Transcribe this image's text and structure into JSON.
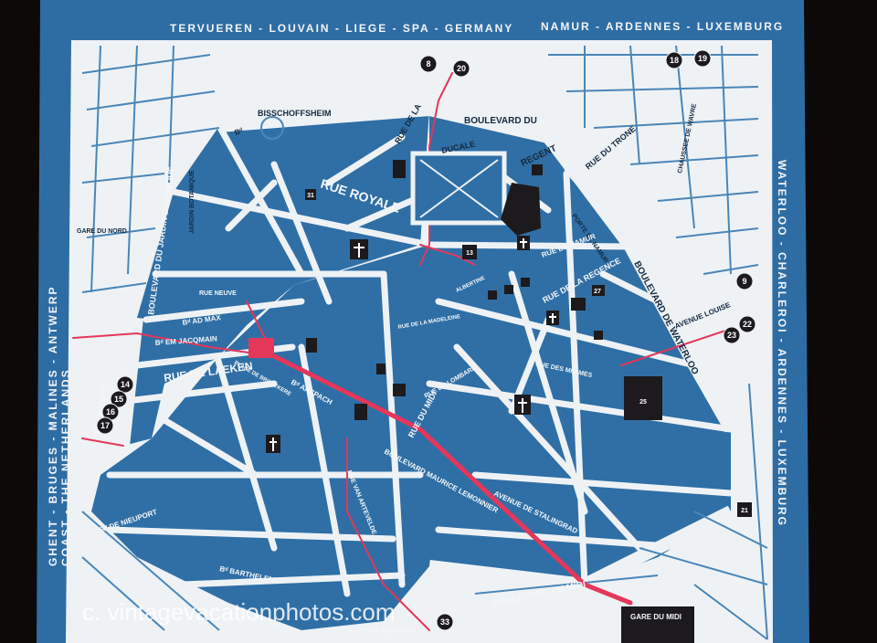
{
  "edges": {
    "top_left": "TERVUEREN - LOUVAIN - LIEGE - SPA - GERMANY",
    "top_right": "NAMUR - ARDENNES - LUXEMBURG",
    "right": "WATERLOO - CHARLEROI - ARDENNES - LUXEMBURG",
    "left_outer": "GHENT - BRUGES - MALINES - ANTWERP",
    "left_inner": "COAST - THE NETHERLANDS"
  },
  "streets": {
    "bisschoffsheim": "BISSCHOFFSHEIM",
    "bd_short": "Bᵈ",
    "boulevard_du_top": "BOULEVARD     DU",
    "ducale": "DUCALE",
    "rue_de_la_loi": "RUE DE LA",
    "regent": "REGENT",
    "rue_du_trone": "RUE DU TRONE",
    "chaussee_wavre": "CHAUSSEE DE WAVRE",
    "jardin": "JARDIN BOTANIQUE",
    "rue_royale": "RUE  ROYALE",
    "porte_namur": "PORTE DE NAMUR",
    "rue_namur": "RUE DE NAMUR",
    "bd_waterloo": "BOULEVARD DE WATERLOO",
    "gare_nord": "GARE DU NORD",
    "bd_jardin_botanique": "BOULEVARD DU JARDIN BOTANIQUE",
    "rue_neuve": "RUE NEUVE",
    "bd_adolphe_max": "Bᵈ AD MAX",
    "bd_jacqmain": "Bᵈ EM JACQMAIN",
    "rue_de_laeken": "RUE  DE  LAEKEN",
    "bd_anvers": "Bᵈ D'ANVERS",
    "place_brouckere": "PLACE DE BROUCKERE",
    "anspach": "Bᵈ ANSPACH",
    "rue_regence": "RUE DE LA REGENCE",
    "avenue_louise": "AVENUE LOUISE",
    "rue_minimes": "RUE DES MINIMES",
    "rue_lombard": "RUE DU LOMBARD",
    "rue_du_midi": "RUE DU MIDI",
    "bd_lemonnier": "BOULEVARD MAURICE LEMONNIER",
    "av_stalingrad": "AVENUE DE STALINGRAD",
    "rue_artevelde": "RUE VAN ARTEVELDE",
    "bd_nieuport": "Bᵈ DE NIEUPORT",
    "bd_barthelemy": "Bᵈ BARTHELEMY",
    "bd_abattoir": "Bᵈ DE L'ABATTOIR",
    "bd_midi": "BOULEVARD     DU MIDI",
    "gare_midi": "GARE DU MIDI",
    "albertine": "ALBERTINE",
    "bd_madeleine": "RUE DE LA MADELEINE"
  },
  "markers": [
    "8",
    "20",
    "18",
    "19",
    "9",
    "22",
    "23",
    "14",
    "15",
    "16",
    "17",
    "13",
    "25",
    "21",
    "33",
    "31",
    "27"
  ],
  "watermark": "c. vintagevacationphotos.com",
  "colors": {
    "paper": "#f1f4f6",
    "block_blue": "#2f6fa6",
    "frame_blue": "#2e6da4",
    "route_red": "#e4375a",
    "marker": "#1c1a1c"
  }
}
